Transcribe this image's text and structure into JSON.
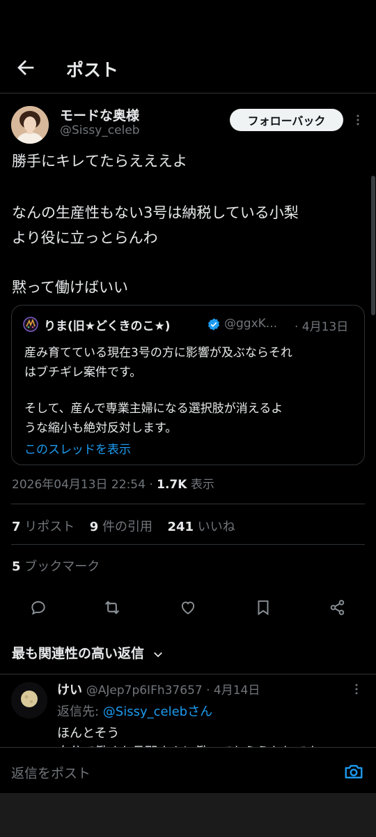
{
  "header": {
    "title": "ポスト"
  },
  "post": {
    "author_name": "モードな奥様",
    "author_handle": "@Sissy_celeb",
    "follow_label": "フォローバック",
    "lines": [
      "勝手にキレてたらえええよ",
      "なんの生産性もない3号は納税している小梨",
      "より役に立っとらんわ",
      "黙って働けばいい"
    ]
  },
  "quote": {
    "name": "りま(旧★どくきのこ★)",
    "handle": "@ggxK...",
    "date": "· 4月13日",
    "lines": [
      "産み育てている現在3号の方に影響が及ぶならそれ",
      "はブチギレ案件です。",
      "そして、産んで専業主婦になる選択肢が消えるよ",
      "うな縮小も絶対反対します。"
    ],
    "thread_link": "このスレッドを表示",
    "verified_color": "#1d9bf0"
  },
  "meta": {
    "datetime": "2026年04月13日 22:54 · ",
    "views_count": "1.7K",
    "views_label": " 表示"
  },
  "stats": {
    "reposts_count": "7",
    "reposts_label": " リポスト",
    "quotes_count": "9",
    "quotes_label": " 件の引用",
    "likes_count": "241",
    "likes_label": " いいね",
    "bookmarks_count": "5",
    "bookmarks_label": " ブックマーク"
  },
  "replies": {
    "section_title": "最も関連性の高い返信",
    "items": [
      {
        "name": "けい",
        "handle_date": "@AJep7p6IFh37657 · 4月14日",
        "replying_prefix": "返信先: ",
        "replying_handle": "@Sissy_celeb",
        "replying_suffix": "さん",
        "text_1": "ほんとそう",
        "text_2": "自分で働くか旦那さんに働いてもらうかしてよ"
      }
    ]
  },
  "composer": {
    "placeholder": "返信をポスト"
  },
  "colors": {
    "accent": "#1d9bf0",
    "muted": "#71767b",
    "text": "#e7e9ea",
    "border": "#2f3336"
  },
  "icons": [
    "back-arrow-icon",
    "more-icon",
    "verified-badge-icon",
    "reply-icon",
    "repost-icon",
    "like-icon",
    "bookmark-icon",
    "share-icon",
    "chevron-down-icon",
    "camera-icon"
  ]
}
